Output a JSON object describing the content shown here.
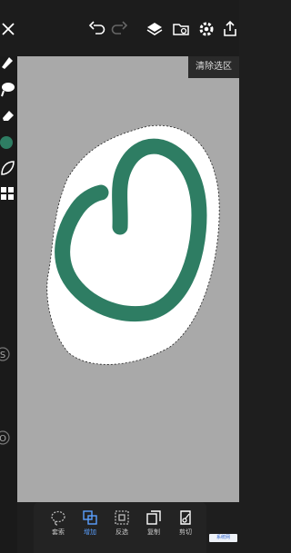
{
  "canvas": {
    "clear_selection_label": "清除选区"
  },
  "bottom_bar": {
    "items": [
      {
        "id": "lasso",
        "label": "套索"
      },
      {
        "id": "add",
        "label": "增加"
      },
      {
        "id": "invert",
        "label": "反选"
      },
      {
        "id": "copy",
        "label": "复制"
      },
      {
        "id": "cut",
        "label": "剪切"
      }
    ],
    "active": "add"
  },
  "brush_color": "#2e7d63",
  "watermark_text": "系统网"
}
